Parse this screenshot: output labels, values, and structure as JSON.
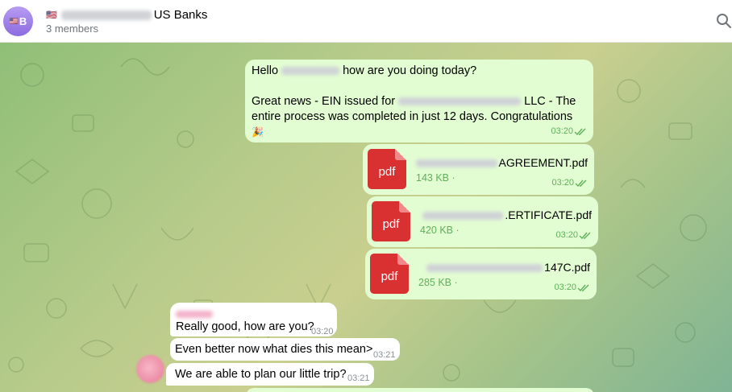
{
  "header": {
    "avatar_initial": "B",
    "avatar_flag": "🇺🇸",
    "title_flag": "🇺🇸",
    "title_suffix": "US Banks",
    "subtitle": "3 members",
    "search_icon": "search-icon"
  },
  "messages": {
    "m1": {
      "greeting_prefix": "Hello",
      "greeting_suffix": "how are you doing today?",
      "line2_prefix": "Great news - EIN issued for",
      "line2_suffix": "LLC - The",
      "line3": "entire process was completed in just 12 days. Congratulations",
      "emoji": "🎉",
      "time": "03:20"
    },
    "files": [
      {
        "name_suffix": "AGREEMENT.pdf",
        "size": "143 KB ·",
        "time": "03:20",
        "icon_label": "pdf"
      },
      {
        "name_suffix": ".ERTIFICATE.pdf",
        "size": "420 KB ·",
        "time": "03:20",
        "icon_label": "pdf"
      },
      {
        "name_suffix": "147C.pdf",
        "size": "285 KB ·",
        "time": "03:20",
        "icon_label": "pdf"
      }
    ],
    "in1": {
      "text": "Really good, how are you?",
      "time": "03:20"
    },
    "in2": {
      "text": "Even better now what dies this mean>",
      "time": "03:21"
    },
    "in3": {
      "text": "We are able to plan our little trip?",
      "time": "03:21"
    }
  },
  "colors": {
    "outgoing_bubble": "#e3fdd3",
    "incoming_bubble": "#ffffff",
    "time_out": "#5fb05a",
    "pdf_red": "#d93031"
  }
}
